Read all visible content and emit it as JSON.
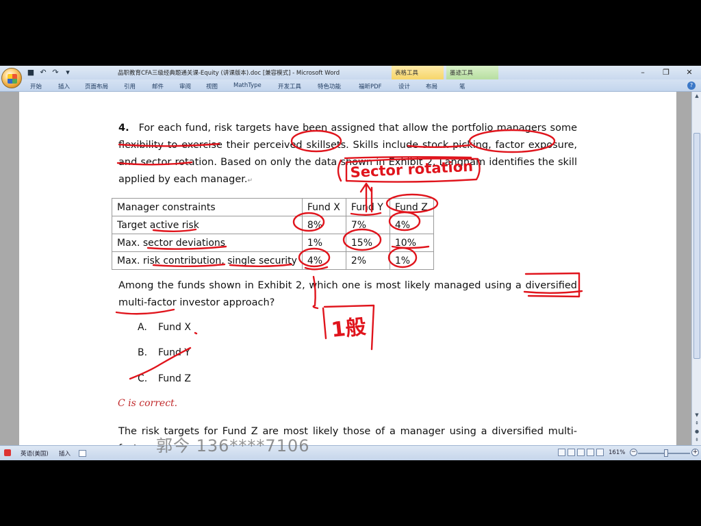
{
  "window": {
    "title": "品职教育CFA三级经典题通关课-Equity (讲课版本).doc [兼容模式] - Microsoft Word",
    "context_tabs": [
      "表格工具",
      "墨迹工具"
    ],
    "controls": {
      "minimize": "–",
      "restore": "❐",
      "close": "✕"
    }
  },
  "qat": {
    "save_icon": "■",
    "undo_icon": "↶",
    "redo_icon": "↷",
    "customize_icon": "▾"
  },
  "ribbon": {
    "tabs": [
      "开始",
      "插入",
      "页面布局",
      "引用",
      "邮件",
      "审阅",
      "视图",
      "MathType",
      "开发工具",
      "特色功能",
      "福昕PDF",
      "设计",
      "布局",
      "笔"
    ]
  },
  "document": {
    "question_number": "4.",
    "question_text": "For each fund, risk targets have been assigned that allow the portfolio managers some flexibility to exercise their perceived skillsets. Skills include stock picking, factor exposure, and sector rotation. Based on only the data shown in Exhibit 2, Langham identifies the skill applied by each manager.",
    "table": {
      "headers": [
        "Manager constraints",
        "Fund X",
        "Fund Y",
        "Fund Z"
      ],
      "rows": [
        [
          "Target active risk",
          "8%",
          "7%",
          "4%"
        ],
        [
          "Max. sector deviations",
          "1%",
          "15%",
          "10%"
        ],
        [
          "Max. risk contribution, single security",
          "4%",
          "2%",
          "1%"
        ]
      ]
    },
    "prompt": "Among the funds shown in Exhibit 2, which one is most likely managed using a diversified multi-factor investor approach?",
    "options": [
      {
        "letter": "A.",
        "text": "Fund X"
      },
      {
        "letter": "B.",
        "text": "Fund Y"
      },
      {
        "letter": "C.",
        "text": "Fund Z"
      }
    ],
    "answer": "C is correct.",
    "explanation": "The risk targets for Fund Z are most likely those of a manager using a diversified multi-factor",
    "paragraph_mark": "↵"
  },
  "handwriting": {
    "sector_note": "Sector rotation",
    "note_cn": "1般"
  },
  "watermark": "郭今 136****7106",
  "statusbar": {
    "language": "英语(美国)",
    "mode": "插入",
    "zoom": "161%"
  },
  "colors": {
    "ink": "#e0141c",
    "answer": "#c0282a"
  }
}
